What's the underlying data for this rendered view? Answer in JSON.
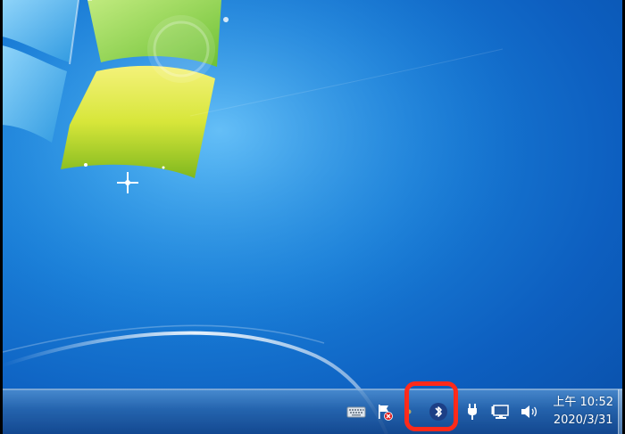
{
  "desktop": {
    "background_colors": [
      "#2a9be8",
      "#0a4fa8"
    ]
  },
  "tray": {
    "icons": [
      {
        "name": "keyboard-icon"
      },
      {
        "name": "action-center-flag-icon"
      },
      {
        "name": "bluetooth-icon"
      },
      {
        "name": "power-plug-icon"
      },
      {
        "name": "network-icon"
      },
      {
        "name": "volume-icon"
      }
    ],
    "clock": {
      "time": "上午 10:52",
      "date": "2020/3/31"
    }
  },
  "highlight_color": "#ff2a1a"
}
